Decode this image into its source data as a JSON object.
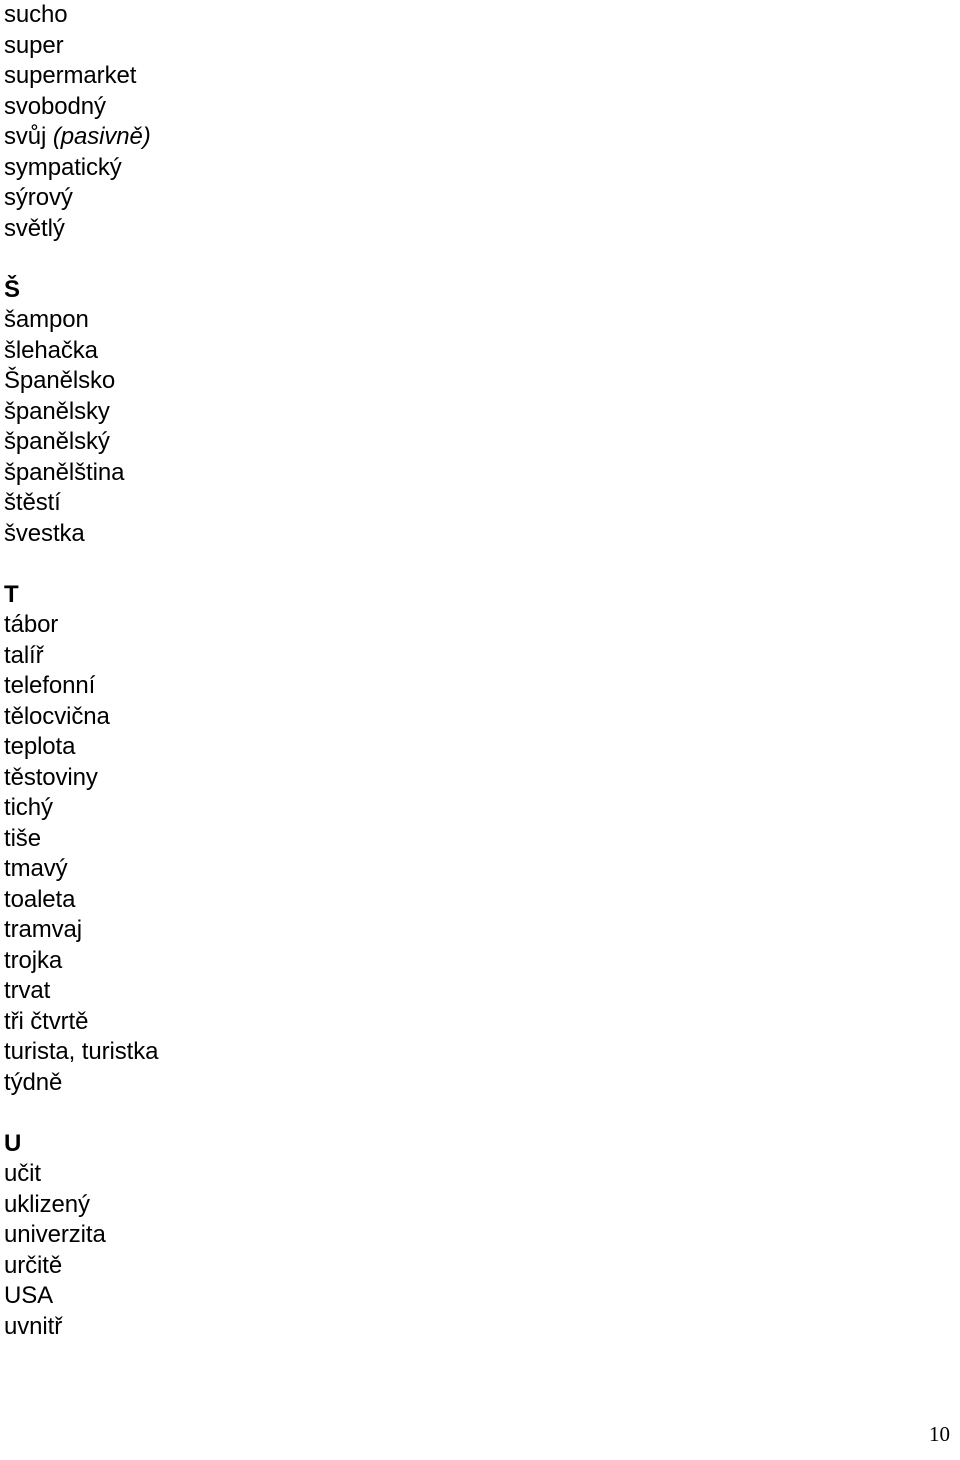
{
  "document": {
    "kind": "vocabulary-word-list",
    "language": "Czech",
    "page_number": "10"
  },
  "blocks": [
    {
      "type": "entry",
      "text": "sucho"
    },
    {
      "type": "entry",
      "text": "super"
    },
    {
      "type": "entry",
      "text": "supermarket"
    },
    {
      "type": "entry",
      "text": "svobodný"
    },
    {
      "type": "entry-with-note",
      "text": "svůj ",
      "note": "(pasivně)"
    },
    {
      "type": "entry",
      "text": "sympatický"
    },
    {
      "type": "entry",
      "text": "sýrový"
    },
    {
      "type": "entry",
      "text": "světlý"
    },
    {
      "type": "spacer"
    },
    {
      "type": "heading",
      "text": "Š"
    },
    {
      "type": "entry",
      "text": "šampon"
    },
    {
      "type": "entry",
      "text": "šlehačka"
    },
    {
      "type": "entry",
      "text": "Španělsko"
    },
    {
      "type": "entry",
      "text": "španělsky"
    },
    {
      "type": "entry",
      "text": "španělský"
    },
    {
      "type": "entry",
      "text": "španělština"
    },
    {
      "type": "entry",
      "text": "štěstí"
    },
    {
      "type": "entry",
      "text": "švestka"
    },
    {
      "type": "spacer"
    },
    {
      "type": "heading",
      "text": "T"
    },
    {
      "type": "entry",
      "text": "tábor"
    },
    {
      "type": "entry",
      "text": "talíř"
    },
    {
      "type": "entry",
      "text": "telefonní"
    },
    {
      "type": "entry",
      "text": "tělocvična"
    },
    {
      "type": "entry",
      "text": "teplota"
    },
    {
      "type": "entry",
      "text": "těstoviny"
    },
    {
      "type": "entry",
      "text": "tichý"
    },
    {
      "type": "entry",
      "text": "tiše"
    },
    {
      "type": "entry",
      "text": "tmavý"
    },
    {
      "type": "entry",
      "text": "toaleta"
    },
    {
      "type": "entry",
      "text": "tramvaj"
    },
    {
      "type": "entry",
      "text": "trojka"
    },
    {
      "type": "entry",
      "text": "trvat"
    },
    {
      "type": "entry",
      "text": "tři čtvrtě"
    },
    {
      "type": "entry",
      "text": "turista, turistka"
    },
    {
      "type": "entry",
      "text": "týdně"
    },
    {
      "type": "spacer"
    },
    {
      "type": "heading",
      "text": "U"
    },
    {
      "type": "entry",
      "text": "učit"
    },
    {
      "type": "entry",
      "text": "uklizený"
    },
    {
      "type": "entry",
      "text": "univerzita"
    },
    {
      "type": "entry",
      "text": "určitě"
    },
    {
      "type": "entry",
      "text": "USA"
    },
    {
      "type": "entry",
      "text": "uvnitř"
    }
  ]
}
